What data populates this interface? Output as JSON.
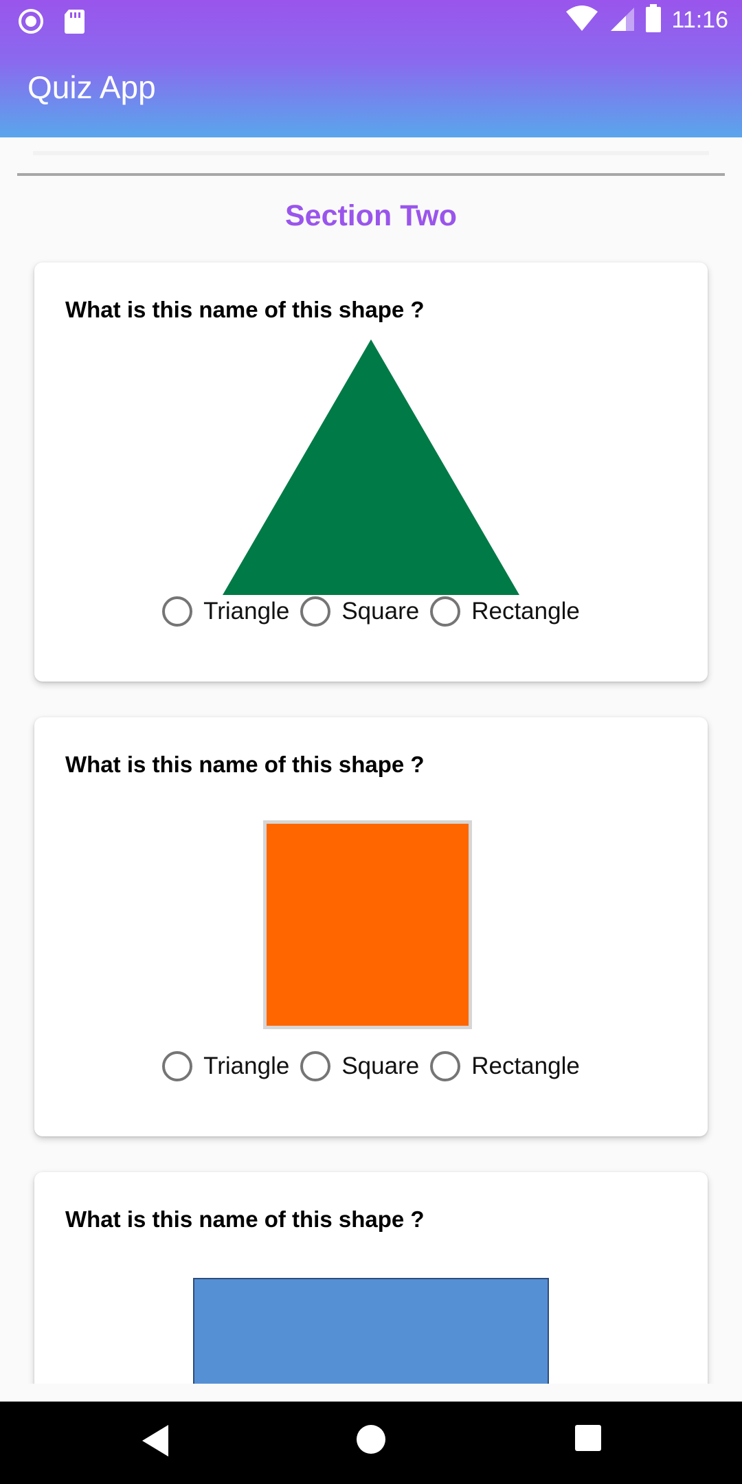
{
  "status": {
    "time": "11:16"
  },
  "app": {
    "title": "Quiz App"
  },
  "section": {
    "title": "Section Two"
  },
  "questions": [
    {
      "text": "What is this name of this shape ?",
      "shape": "triangle",
      "shape_color": "#007a46",
      "options": [
        "Triangle",
        "Square",
        "Rectangle"
      ]
    },
    {
      "text": "What is this name of this shape ?",
      "shape": "square",
      "shape_color": "#ff6600",
      "options": [
        "Triangle",
        "Square",
        "Rectangle"
      ]
    },
    {
      "text": "What is this name of this shape ?",
      "shape": "rectangle",
      "shape_color": "#5690d4"
    }
  ],
  "colors": {
    "accent": "#9a55ec",
    "appbar_gradient_end": "#59a6ec"
  },
  "nav": {
    "back_icon": "back-icon",
    "home_icon": "home-icon",
    "recents_icon": "recents-icon"
  }
}
